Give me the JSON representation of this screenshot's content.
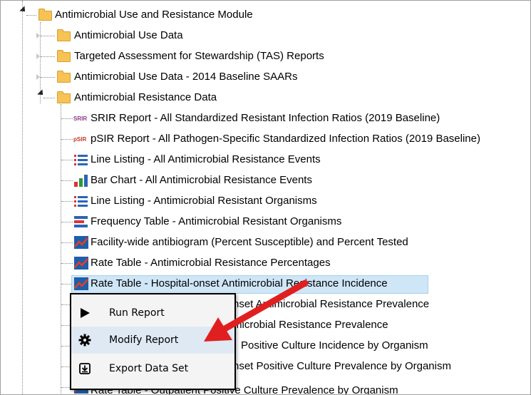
{
  "tree": {
    "root": {
      "label": "Antimicrobial Use and Resistance Module"
    },
    "folders": [
      {
        "label": "Antimicrobial Use Data"
      },
      {
        "label": "Targeted Assessment for Stewardship (TAS) Reports"
      },
      {
        "label": "Antimicrobial Use Data - 2014 Baseline SAARs"
      },
      {
        "label": "Antimicrobial Resistance Data"
      }
    ],
    "reports": [
      {
        "label": "SRIR Report - All Standardized Resistant Infection Ratios (2019 Baseline)",
        "icon": "srir-icon",
        "icon_text": "SRIR"
      },
      {
        "label": "pSIR Report - All Pathogen-Specific Standardized Infection Ratios (2019 Baseline)",
        "icon": "psir-icon",
        "icon_text": "pSIR"
      },
      {
        "label": "Line Listing - All Antimicrobial Resistance Events",
        "icon": "line-listing-icon"
      },
      {
        "label": "Bar Chart - All Antimicrobial Resistance Events",
        "icon": "bar-chart-icon"
      },
      {
        "label": "Line Listing - Antimicrobial Resistant Organisms",
        "icon": "line-listing-icon"
      },
      {
        "label": "Frequency Table - Antimicrobial Resistant Organisms",
        "icon": "frequency-table-icon"
      },
      {
        "label": "Facility-wide antibiogram (Percent Susceptible) and Percent Tested",
        "icon": "rate-table-icon"
      },
      {
        "label": "Rate Table - Antimicrobial Resistance Percentages",
        "icon": "rate-table-icon"
      },
      {
        "label": "Rate Table - Hospital-onset Antimicrobial Resistance Incidence",
        "icon": "rate-table-icon",
        "selected": true
      },
      {
        "label": "nset Antimicrobial Resistance Prevalence",
        "icon": "rate-table-icon"
      },
      {
        "label": "microbial Resistance Prevalence",
        "icon": "rate-table-icon"
      },
      {
        "label": "Positive Culture Incidence by Organism",
        "icon": "rate-table-icon"
      },
      {
        "label": "nset Positive Culture Prevalence by Organism",
        "icon": "rate-table-icon"
      },
      {
        "label": "Rate Table - Outpatient Positive Culture Prevalence by Organism",
        "icon": "rate-table-icon"
      }
    ]
  },
  "context_menu": {
    "items": [
      {
        "label": "Run Report",
        "icon": "play-icon"
      },
      {
        "label": "Modify Report",
        "icon": "gear-icon",
        "hover": true
      },
      {
        "label": "Export Data Set",
        "icon": "export-icon"
      }
    ]
  },
  "colors": {
    "folder": "#f6c354",
    "selection": "#cfe6f7",
    "arrow": "#e02020",
    "menu_bg": "#f4f4f4",
    "menu_hover": "#dfe9f3"
  }
}
